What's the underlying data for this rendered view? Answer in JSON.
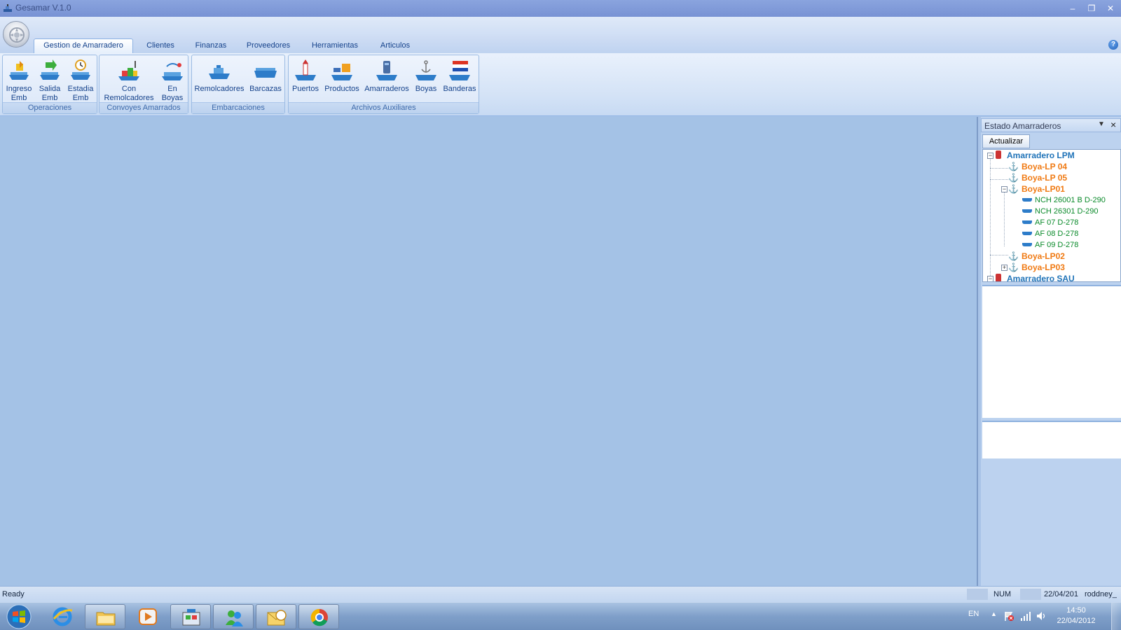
{
  "window": {
    "title": "Gesamar V.1.0"
  },
  "ribbon": {
    "tabs": [
      "Gestion de Amarradero",
      "Clientes",
      "Finanzas",
      "Proveedores",
      "Herramientas",
      "Articulos"
    ],
    "groups": {
      "operaciones": {
        "label": "Operaciones",
        "buttons": {
          "ingreso": "Ingreso\nEmb",
          "salida": "Salida\nEmb",
          "estadia": "Estadia\nEmb"
        }
      },
      "convoyes": {
        "label": "Convoyes Amarrados",
        "buttons": {
          "remolcadores": "Con\nRemolcadores",
          "boyas": "En\nBoyas"
        }
      },
      "embarcaciones": {
        "label": "Embarcaciones",
        "buttons": {
          "remolcadores": "Remolcadores",
          "barcazas": "Barcazas"
        }
      },
      "archivos": {
        "label": "Archivos Auxiliares",
        "buttons": {
          "puertos": "Puertos",
          "productos": "Productos",
          "amarraderos": "Amarraderos",
          "boyas": "Boyas",
          "banderas": "Banderas"
        }
      }
    }
  },
  "panel": {
    "title": "Estado Amarraderos",
    "refresh_label": "Actualizar",
    "tree": {
      "root1": "Amarradero LPM",
      "buoy1": "Boya-LP 04",
      "buoy2": "Boya-LP 05",
      "buoy3": "Boya-LP01",
      "ships": [
        "NCH 26001 B D-290",
        "NCH 26301 D-290",
        "AF 07 D-278",
        "AF 08 D-278",
        "AF 09 D-278"
      ],
      "buoy4": "Boya-LP02",
      "buoy5": "Boya-LP03",
      "root2": "Amarradero SAU"
    }
  },
  "statusbar": {
    "left": "Ready",
    "num": "NUM",
    "date": "22/04/201",
    "user": "roddney_"
  },
  "taskbar": {
    "lang": "EN",
    "time": "14:50",
    "date": "22/04/2012"
  },
  "colors": {
    "accent": "#15428b",
    "root_node": "#1f73b8",
    "buoy_node": "#f07a13",
    "ship_node": "#0a8a2a",
    "workspace": "#a4c2e6"
  }
}
